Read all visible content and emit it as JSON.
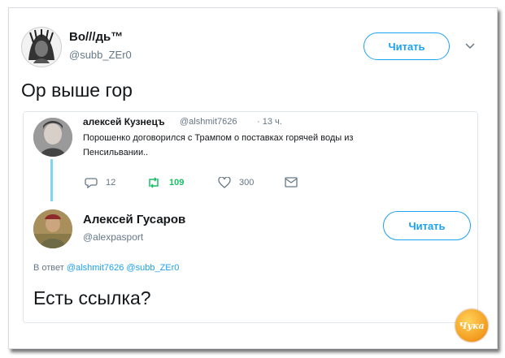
{
  "main_tweet": {
    "author_name": "Во///дь™",
    "handle": "@subb_ZEr0",
    "follow_label": "Читать",
    "text": "Ор выше гор"
  },
  "quoted_tweet": {
    "author_name": "алексей Кузнецъ",
    "handle": "@alshmit7626",
    "time": "· 13 ч.",
    "text_line1": "Порошенко договорился с Трампом о поставках горячей воды из",
    "text_line2": "Пенсильвании..",
    "reply_count": "12",
    "retweet_count": "109",
    "like_count": "300"
  },
  "reply_tweet": {
    "author_name": "Алексей Гусаров",
    "handle": "@alexpasport",
    "follow_label": "Читать",
    "reply_to_prefix": "В ответ",
    "reply_to_handles": "@alshmit7626 @subb_ZEr0",
    "text": "Есть ссылка?"
  },
  "watermark": {
    "text": "Чука"
  },
  "colors": {
    "accent": "#1da1f2",
    "retweet": "#17bf63",
    "thread": "#7fd3f3",
    "muted": "#657786"
  }
}
